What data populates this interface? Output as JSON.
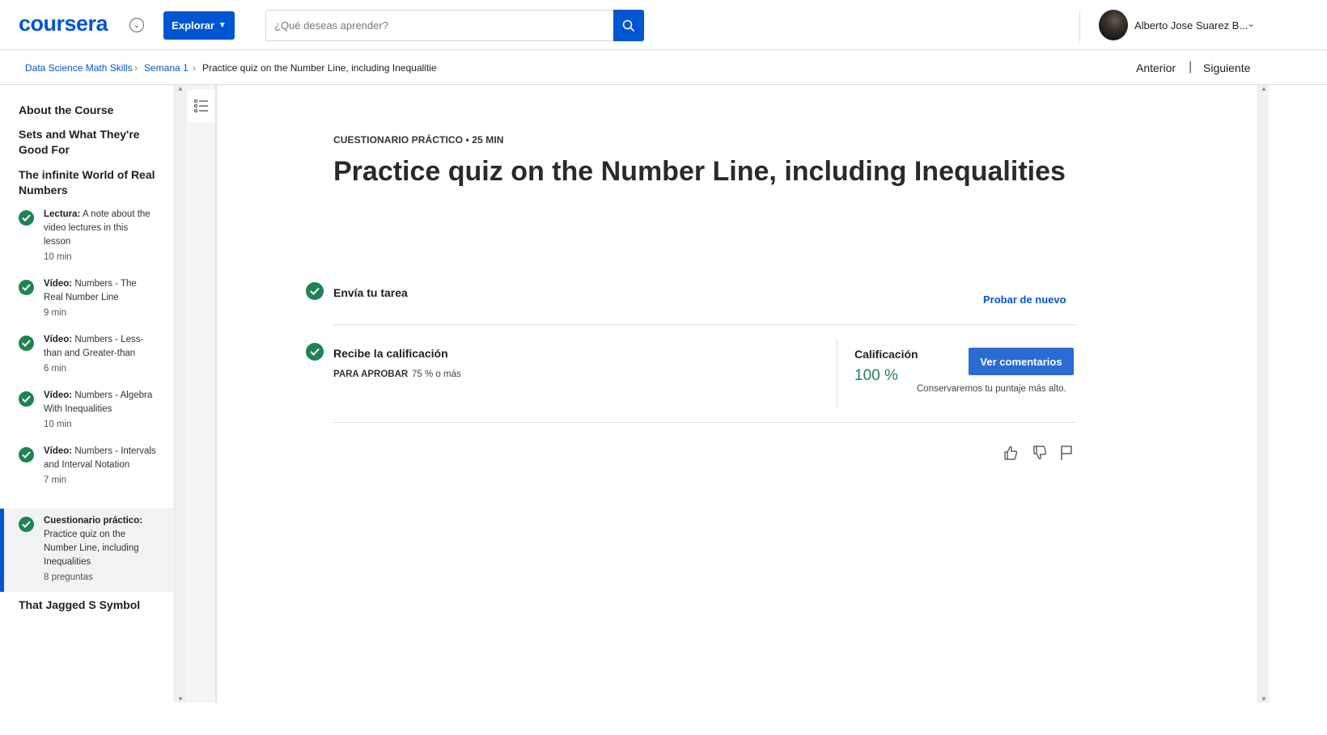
{
  "header": {
    "logo": "coursera",
    "explore_label": "Explorar",
    "search_placeholder": "¿Qué deseas aprender?",
    "user_name": "Alberto Jose Suarez B..."
  },
  "breadcrumb": {
    "items": [
      "Data Science Math Skills",
      "Semana 1",
      "Practice quiz on the Number Line, including Inequalities"
    ],
    "prev": "Anterior",
    "separator": "|",
    "next": "Siguiente"
  },
  "sidebar": {
    "sections": [
      "About the Course",
      "Sets and What They're Good For",
      "The infinite World of Real Numbers",
      "That Jagged S Symbol"
    ],
    "items": [
      {
        "type": "Lectura:",
        "title": "A note about the video lectures in this lesson",
        "meta": "10 min",
        "completed": true
      },
      {
        "type": "Vídeo:",
        "title": "Numbers - The Real Number Line",
        "meta": "9 min",
        "completed": true
      },
      {
        "type": "Vídeo:",
        "title": "Numbers - Less-than and Greater-than",
        "meta": "6 min",
        "completed": true
      },
      {
        "type": "Vídeo:",
        "title": "Numbers - Algebra With Inequalities",
        "meta": "10 min",
        "completed": true
      },
      {
        "type": "Vídeo:",
        "title": "Numbers - Intervals and Interval Notation",
        "meta": "7 min",
        "completed": true
      },
      {
        "type": "Cuestionario práctico:",
        "title": "Practice quiz on the Number Line, including Inequalities",
        "meta": "8 preguntas",
        "completed": true,
        "active": true
      }
    ]
  },
  "main": {
    "kicker": "CUESTIONARIO PRÁCTICO • 25 MIN",
    "title": "Practice quiz on the Number Line, including Inequalities",
    "step1_title": "Envía tu tarea",
    "retry_label": "Probar de nuevo",
    "step2_title": "Recibe la calificación",
    "pass_label": "PARA APROBAR",
    "pass_value": "75 % o más",
    "grade_label": "Calificación",
    "grade_value": "100 %",
    "feedback_button": "Ver comentarios",
    "keep_note": "Conservaremos tu puntaje más alto."
  },
  "colors": {
    "brand": "#0056d2",
    "success": "#1f8354",
    "button": "#2a6bd4"
  }
}
